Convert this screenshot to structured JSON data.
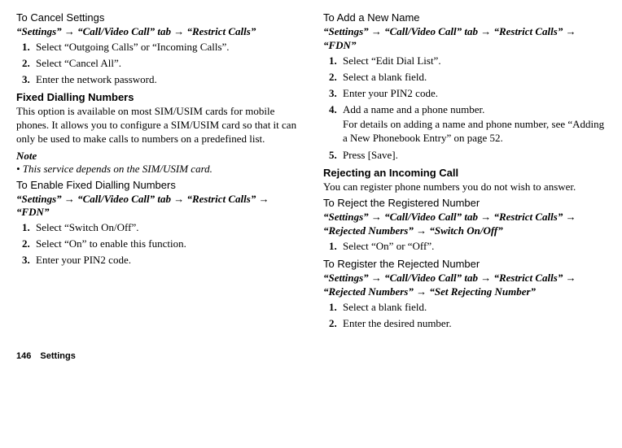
{
  "left": {
    "cancelSettings": {
      "title": "To Cancel Settings",
      "path": "“Settings” → “Call/Video Call” tab → “Restrict Calls”",
      "steps": [
        "Select “Outgoing Calls” or “Incoming Calls”.",
        "Select “Cancel All”.",
        "Enter the network password."
      ]
    },
    "fdn": {
      "title": "Fixed Dialling Numbers",
      "body": "This option is available on most SIM/USIM cards for mobile phones. It allows you to configure a SIM/USIM card so that it can only be used to make calls to numbers on a predefined list.",
      "noteLabel": "Note",
      "noteItem": "• This service depends on the SIM/USIM card."
    },
    "enableFdn": {
      "title": "To Enable Fixed Dialling Numbers",
      "path": "“Settings” → “Call/Video Call” tab → “Restrict Calls” → “FDN”",
      "steps": [
        "Select “Switch On/Off”.",
        "Select “On” to enable this function.",
        "Enter your PIN2 code."
      ]
    }
  },
  "right": {
    "addName": {
      "title": "To Add a New Name",
      "path": "“Settings” → “Call/Video Call” tab → “Restrict Calls” → “FDN”",
      "steps": [
        "Select “Edit Dial List”.",
        "Select a blank field.",
        "Enter your PIN2 code.",
        "Add a name and a phone number.",
        "Press [Save]."
      ],
      "step4detail": "For details on adding a name and phone number, see “Adding a New Phonebook Entry” on page 52."
    },
    "reject": {
      "title": "Rejecting an Incoming Call",
      "body": "You can register phone numbers you do not wish to answer."
    },
    "rejectRegistered": {
      "title": "To Reject the Registered Number",
      "path": "“Settings” → “Call/Video Call” tab → “Restrict Calls” → “Rejected Numbers” → “Switch On/Off”",
      "steps": [
        "Select “On” or “Off”."
      ]
    },
    "registerRejected": {
      "title": "To Register the Rejected Number",
      "path": "“Settings” → “Call/Video Call” tab → “Restrict Calls” → “Rejected Numbers” → “Set Rejecting Number”",
      "steps": [
        "Select a blank field.",
        "Enter the desired number."
      ]
    }
  },
  "footer": {
    "page": "146",
    "section": "Settings"
  }
}
